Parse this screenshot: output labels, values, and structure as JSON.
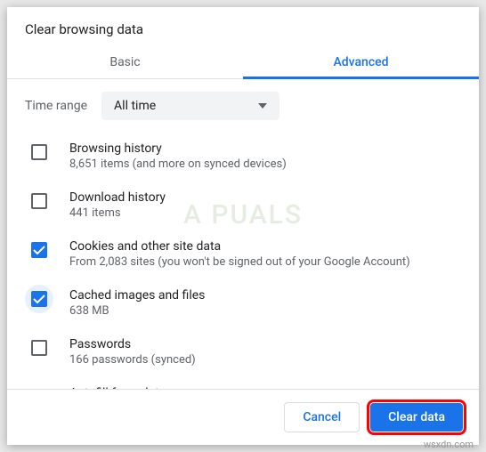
{
  "dialog": {
    "title": "Clear browsing data"
  },
  "tabs": {
    "basic": "Basic",
    "advanced": "Advanced"
  },
  "time": {
    "label": "Time range",
    "selected": "All time"
  },
  "items": [
    {
      "title": "Browsing history",
      "sub": "8,651 items (and more on synced devices)",
      "checked": false,
      "focused": false
    },
    {
      "title": "Download history",
      "sub": "441 items",
      "checked": false,
      "focused": false
    },
    {
      "title": "Cookies and other site data",
      "sub": "From 2,083 sites (you won't be signed out of your Google Account)",
      "checked": true,
      "focused": false
    },
    {
      "title": "Cached images and files",
      "sub": "638 MB",
      "checked": true,
      "focused": true
    },
    {
      "title": "Passwords",
      "sub": "166 passwords (synced)",
      "checked": false,
      "focused": false
    },
    {
      "title": "Autofill form data",
      "sub": "",
      "checked": false,
      "focused": false
    }
  ],
  "footer": {
    "cancel": "Cancel",
    "clear": "Clear data"
  },
  "watermark": "A  PUALS",
  "domain_label": "wsxdn.com"
}
